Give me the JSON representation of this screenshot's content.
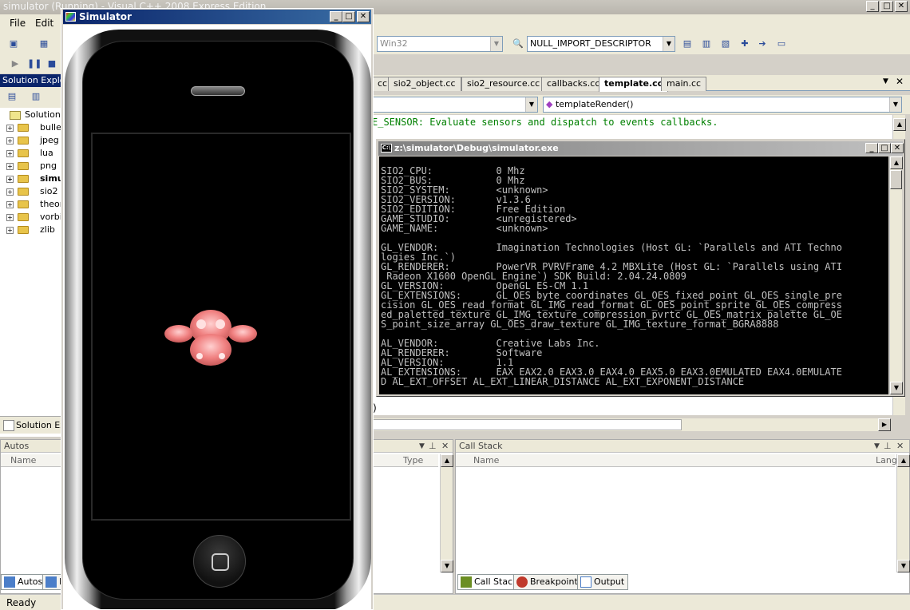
{
  "vs": {
    "title": "simulator (Running) - Visual C++ 2008 Express Edition",
    "menu": [
      "File",
      "Edit"
    ],
    "platform_combo": "Win32",
    "symbol_combo": "NULL_IMPORT_DESCRIPTOR",
    "tabs": [
      {
        "label": "cc"
      },
      {
        "label": "sio2_object.cc"
      },
      {
        "label": "sio2_resource.cc"
      },
      {
        "label": "callbacks.cc"
      },
      {
        "label": "template.cc",
        "active": true
      },
      {
        "label": "main.cc"
      }
    ],
    "function_combo": "templateRender()",
    "editor_line": "E_SENSOR: Evaluate sensors and dispatch to events callbacks.",
    "editor_bottom": ")",
    "status": "Ready"
  },
  "console": {
    "title": "z:\\simulator\\Debug\\simulator.exe",
    "lines": [
      "SIO2_CPU:           0 Mhz",
      "SIO2_BUS:           0 Mhz",
      "SIO2_SYSTEM:        <unknown>",
      "SIO2_VERSION:       v1.3.6",
      "SIO2_EDITION:       Free Edition",
      "GAME_STUDIO:        <unregistered>",
      "GAME_NAME:          <unknown>",
      "",
      "GL_VENDOR:          Imagination Technologies (Host GL: `Parallels and ATI Techno",
      "logies Inc.`)",
      "GL_RENDERER:        PowerVR PVRVFrame 4.2 MBXLite (Host GL: `Parallels using ATI",
      " Radeon X1600 OpenGL Engine`) SDK Build: 2.04.24.0809",
      "GL_VERSION:         OpenGL ES-CM 1.1",
      "GL_EXTENSIONS:      GL_OES_byte_coordinates GL_OES_fixed_point GL_OES_single_pre",
      "cision GL_OES_read_format GL_IMG_read_format GL_OES_point_sprite GL_OES_compress",
      "ed_paletted_texture GL_IMG_texture_compression_pvrtc GL_OES_matrix_palette GL_OE",
      "S_point_size_array GL_OES_draw_texture GL_IMG_texture_format_BGRA8888",
      "",
      "AL_VENDOR:          Creative Labs Inc.",
      "AL_RENDERER:        Software",
      "AL_VERSION:         1.1",
      "AL_EXTENSIONS:      EAX EAX2.0 EAX3.0 EAX4.0 EAX5.0 EAX3.0EMULATED EAX4.0EMULATE",
      "D AL_EXT_OFFSET AL_EXT_LINEAR_DISTANCE AL_EXT_EXPONENT_DISTANCE"
    ]
  },
  "solution": {
    "header": "Solution Explor",
    "root": "Solution 'sim",
    "items": [
      "bullet",
      "jpeg",
      "lua",
      "png",
      "simu",
      "sio2",
      "theor",
      "vorbis",
      "zlib"
    ],
    "bottom_tab": "Solution Exp"
  },
  "autos": {
    "header": "Autos",
    "col_name": "Name",
    "col_type": "Type",
    "tab_autos": "Autos",
    "tab_locals": "L"
  },
  "callstack": {
    "header": "Call Stack",
    "col_name": "Name",
    "col_lang": "Lang",
    "tabs": [
      "Call Stack",
      "Breakpoints",
      "Output"
    ]
  },
  "simulator": {
    "title": "Simulator"
  },
  "colors": {
    "accent_title": "#0a246a",
    "console_bg": "#000000",
    "console_fg": "#c0c0c0",
    "editor_comment": "#008000",
    "monkey": "#f08080"
  }
}
